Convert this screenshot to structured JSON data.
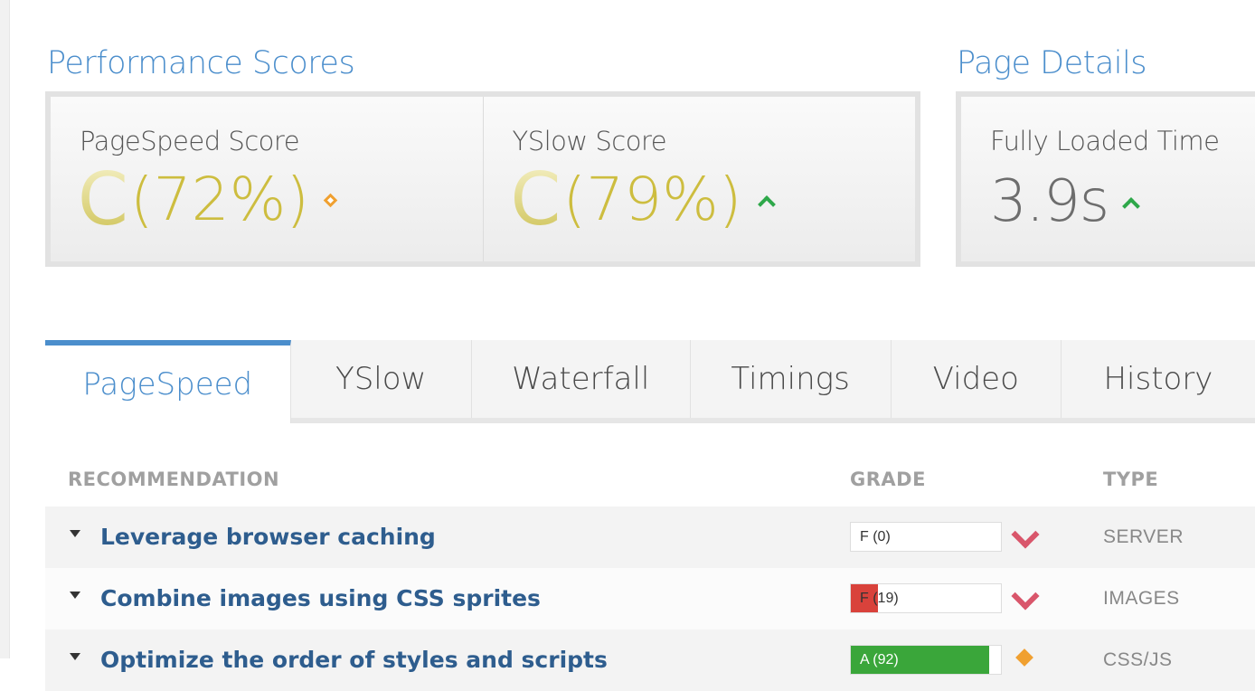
{
  "performance": {
    "title": "Performance Scores",
    "pagespeed": {
      "label": "PageSpeed Score",
      "grade": "C",
      "percent": "(72%)",
      "indicator": "diamond-icon"
    },
    "yslow": {
      "label": "YSlow Score",
      "grade": "C",
      "percent": "(79%)",
      "indicator": "arrow-up-icon"
    }
  },
  "details": {
    "title": "Page Details",
    "fully_loaded": {
      "label": "Fully Loaded Time",
      "value": "3.9s",
      "indicator": "arrow-up-icon"
    }
  },
  "tabs": [
    {
      "label": "PageSpeed",
      "active": true
    },
    {
      "label": "YSlow"
    },
    {
      "label": "Waterfall"
    },
    {
      "label": "Timings"
    },
    {
      "label": "Video"
    },
    {
      "label": "History"
    }
  ],
  "table": {
    "headers": {
      "recommendation": "RECOMMENDATION",
      "grade": "GRADE",
      "type": "TYPE"
    },
    "rows": [
      {
        "recommendation": "Leverage browser caching",
        "grade": "F (0)",
        "score": 0,
        "type": "SERVER",
        "indicator": "chevron-down-icon"
      },
      {
        "recommendation": "Combine images using CSS sprites",
        "grade": "F (19)",
        "score": 19,
        "type": "IMAGES",
        "indicator": "chevron-down-icon"
      },
      {
        "recommendation": "Optimize the order of styles and scripts",
        "grade": "A (92)",
        "score": 92,
        "type": "CSS/JS",
        "indicator": "diamond-icon"
      }
    ]
  },
  "colors": {
    "accent": "#4b8ecc",
    "grade_c": "#cdbd3f",
    "fail": "#d9423b",
    "pass": "#3aa63a",
    "down": "#d9566b",
    "up": "#2ea84a",
    "neutral": "#f0a030"
  }
}
